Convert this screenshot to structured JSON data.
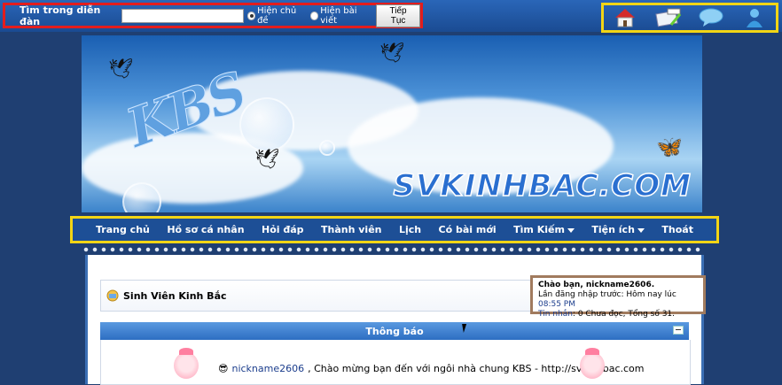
{
  "search": {
    "label": "Tìm trong diễn đàn",
    "value": "",
    "option_topic": "Hiện chủ đề",
    "option_post": "Hiện bài viết",
    "submit": "Tiếp Tục"
  },
  "top_icons": [
    "home-icon",
    "blog-icon",
    "chat-bubble-icon",
    "user-icon"
  ],
  "banner": {
    "logo_text": "KBS",
    "site_name": "SVKINHBAC.COM"
  },
  "nav": {
    "items": [
      "Trang chủ",
      "Hồ sơ cá nhân",
      "Hỏi đáp",
      "Thành viên",
      "Lịch",
      "Có bài mới",
      "Tìm Kiếm",
      "Tiện ích",
      "Thoát"
    ]
  },
  "forum": {
    "title": "Sinh Viên Kinh Bắc"
  },
  "user": {
    "greeting": "Chào bạn, nickname2606.",
    "last_login_label": "Lần đăng nhập trước: Hôm nay lúc",
    "last_login_time": "08:55 PM",
    "messages_label": "Tin nhắn",
    "messages_detail": ": 0 Chưa đọc, Tổng số 31."
  },
  "notice": {
    "header": "Thông báo",
    "nickname": "nickname2606",
    "message": ", Chào mừng bạn đến với ngôi nhà chung KBS - http://svkinhbac.com"
  },
  "colors": {
    "search_highlight": "#e31d1d",
    "icons_highlight": "#f2d515",
    "nav_highlight": "#f2d515",
    "user_highlight": "#a17b5e"
  }
}
